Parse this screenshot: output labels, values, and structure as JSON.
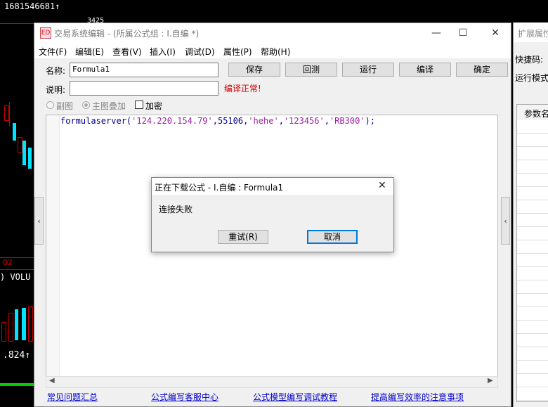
{
  "background": {
    "top_value": "1681546681",
    "top_arrow": "↑",
    "price_label": "3425",
    "series_label": "02",
    "volume_label": ") VOLU",
    "bottom_value": ".824",
    "bottom_arrow": "↑"
  },
  "window": {
    "title": "交易系统编辑 - (所属公式组 : I.自编 *)",
    "app_icon": "ED",
    "minimize": "—",
    "maximize": "☐",
    "close": "✕"
  },
  "menu": [
    "文件(F)",
    "编辑(E)",
    "查看(V)",
    "插入(I)",
    "调试(D)",
    "属性(P)",
    "帮助(H)"
  ],
  "form": {
    "name_label": "名称:",
    "name_value": "Formula1",
    "desc_label": "说明:",
    "desc_value": "",
    "compile_status": "编译正常!",
    "buttons": [
      "保存",
      "回测",
      "运行",
      "编译",
      "确定"
    ],
    "options": {
      "sub_chart": "副图",
      "main_overlay": "主图叠加",
      "encrypt": "加密"
    }
  },
  "editor": {
    "code_fn": "formulaserver(",
    "code_arg1": "'124.220.154.79'",
    "code_mid": ",55106,",
    "code_arg2": "'hehe'",
    "code_comma1": ",",
    "code_arg3": "'123456'",
    "code_comma2": ",",
    "code_arg4": "'RB300'",
    "code_end": ");"
  },
  "links": [
    "常见问题汇总",
    "公式编写客服中心",
    "公式模型编写调试教程",
    "提高编写效率的注意事项"
  ],
  "side_tab": "‹",
  "right_panel": {
    "title": "扩展属性",
    "shortcut_label": "快捷码:",
    "run_mode_label": "运行模式",
    "param_header": "参数名"
  },
  "dialog": {
    "title": "正在下载公式 - I.自编 : Formula1",
    "close": "✕",
    "message": "连接失败",
    "retry_button": "重试(R)",
    "cancel_button": "取消"
  },
  "colors": {
    "code_string": "#9b1fa1",
    "code_default": "#00008b",
    "status_red": "#cc0000",
    "candle_cyan": "#00e5ff",
    "link_blue": "#0000cc"
  }
}
